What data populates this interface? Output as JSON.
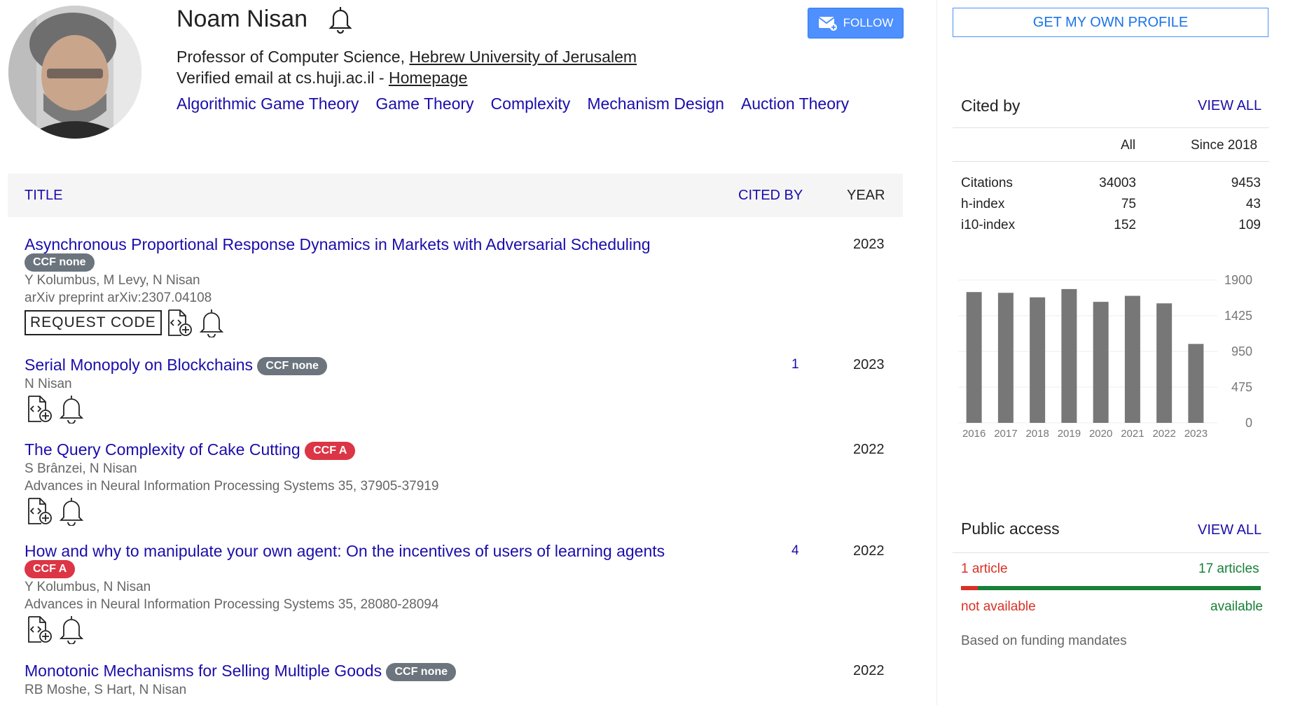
{
  "profile": {
    "name": "Noam Nisan",
    "follow_label": "FOLLOW",
    "affiliation_prefix": "Professor of Computer Science, ",
    "affiliation_link": "Hebrew University of Jerusalem",
    "email_text": "Verified email at cs.huji.ac.il - ",
    "homepage_label": "Homepage",
    "interests": [
      "Algorithmic Game Theory",
      "Game Theory",
      "Complexity",
      "Mechanism Design",
      "Auction Theory"
    ]
  },
  "table": {
    "col_title": "TITLE",
    "col_cited": "CITED BY",
    "col_year": "YEAR"
  },
  "articles": [
    {
      "title": "Asynchronous Proportional Response Dynamics in Markets with Adversarial Scheduling",
      "badge": "CCF none",
      "authors": "Y Kolumbus, M Levy, N Nisan",
      "venue": "arXiv preprint arXiv:2307.04108",
      "cites": "",
      "year": "2023",
      "request_code": "REQUEST CODE"
    },
    {
      "title": "Serial Monopoly on Blockchains",
      "badge": "CCF none",
      "authors": "N Nisan",
      "venue": "",
      "cites": "1",
      "year": "2023"
    },
    {
      "title": "The Query Complexity of Cake Cutting",
      "badge": "CCF A",
      "authors": "S Brânzei, N Nisan",
      "venue": "Advances in Neural Information Processing Systems 35, 37905-37919",
      "cites": "",
      "year": "2022"
    },
    {
      "title": "How and why to manipulate your own agent: On the incentives of users of learning agents",
      "badge": "CCF A",
      "authors": "Y Kolumbus, N Nisan",
      "venue": "Advances in Neural Information Processing Systems 35, 28080-28094",
      "cites": "4",
      "year": "2022"
    },
    {
      "title": "Monotonic Mechanisms for Selling Multiple Goods",
      "badge": "CCF none",
      "authors": "RB Moshe, S Hart, N Nisan",
      "venue": "",
      "cites": "",
      "year": "2022"
    }
  ],
  "sidebar": {
    "get_profile": "GET MY OWN PROFILE",
    "cited_by": "Cited by",
    "view_all": "VIEW ALL",
    "col_all": "All",
    "col_since": "Since 2018",
    "stats": [
      {
        "label": "Citations",
        "all": "34003",
        "since": "9453"
      },
      {
        "label": "h-index",
        "all": "75",
        "since": "43"
      },
      {
        "label": "i10-index",
        "all": "152",
        "since": "109"
      }
    ],
    "public_access": "Public access",
    "pa_view_all": "VIEW ALL",
    "pa_left": "1 article",
    "pa_right": "17 articles",
    "pa_not_available": "not available",
    "pa_available": "available",
    "pa_note": "Based on funding mandates",
    "pa_fraction_unavailable": 0.056
  },
  "chart_data": {
    "type": "bar",
    "categories": [
      "2016",
      "2017",
      "2018",
      "2019",
      "2020",
      "2021",
      "2022",
      "2023"
    ],
    "values": [
      1740,
      1730,
      1670,
      1780,
      1610,
      1690,
      1590,
      1050
    ],
    "yticks": [
      "1900",
      "1425",
      "950",
      "475",
      "0"
    ],
    "ylim": [
      0,
      1900
    ],
    "bar_color": "#777777"
  }
}
